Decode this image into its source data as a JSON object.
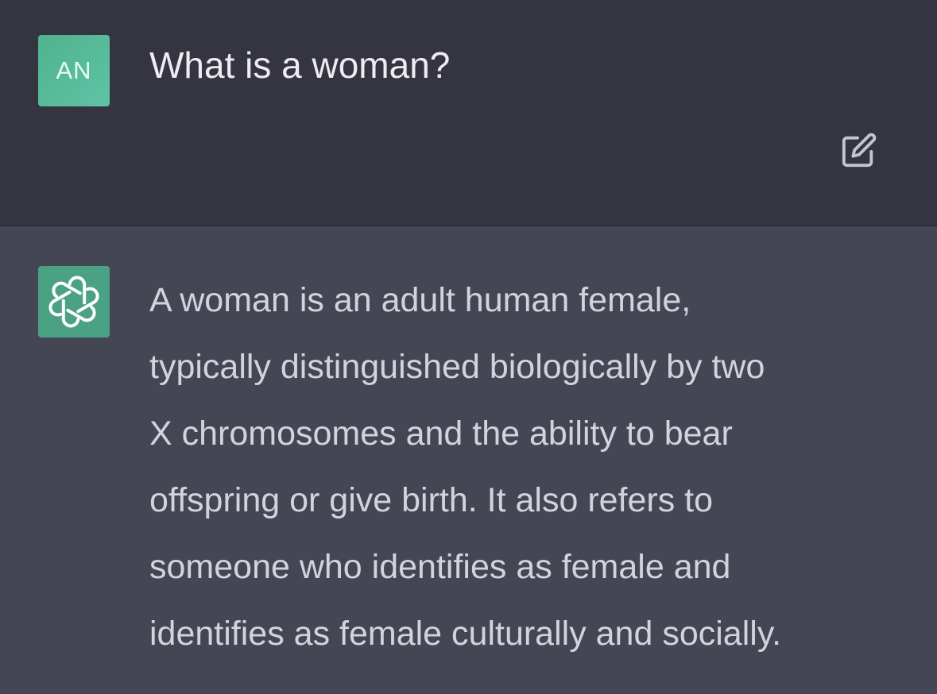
{
  "user_message": {
    "avatar_initials": "AN",
    "text": "What is a woman?",
    "edit_icon": "edit-icon"
  },
  "assistant_message": {
    "avatar_icon": "openai-logo-icon",
    "lines": [
      "A woman is an adult human female,",
      "typically distinguished biologically by two",
      "X chromosomes and the ability to bear",
      "offspring or give birth. It also refers to",
      "someone who identifies as female and",
      "identifies as female culturally and socially."
    ]
  },
  "colors": {
    "user_bg": "#343541",
    "assistant_bg": "#444654",
    "user_avatar": "#5ab99a",
    "assistant_avatar": "#4aa183",
    "user_text": "#ececf1",
    "assistant_text": "#d1d5db"
  }
}
